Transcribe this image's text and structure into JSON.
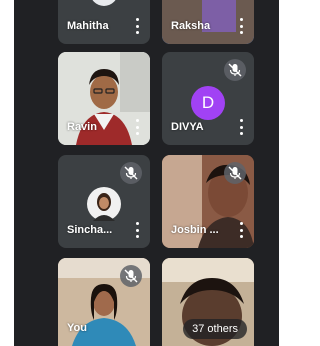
{
  "accent_color": "#1a73e8",
  "avatar_color": "#a142f4",
  "participants": [
    {
      "name": "Mahitha"
    },
    {
      "name": "Raksha"
    },
    {
      "name": "Ravin"
    },
    {
      "name": "DIVYA",
      "initial": "D"
    },
    {
      "name": "Sincha..."
    },
    {
      "name": "Josbin ..."
    },
    {
      "name": "You"
    }
  ],
  "overflow": {
    "label": "37 others"
  }
}
